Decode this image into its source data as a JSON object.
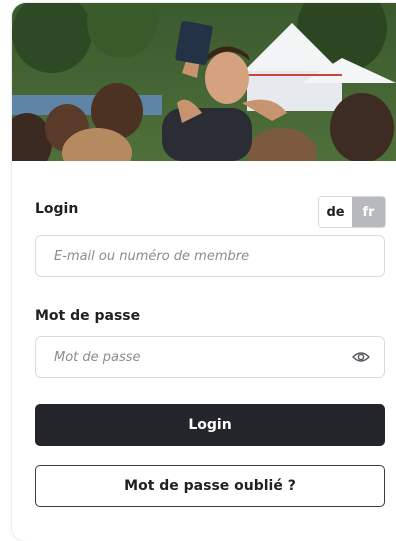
{
  "login": {
    "label": "Login",
    "placeholder": "E-mail ou numéro de membre"
  },
  "language": {
    "options": [
      "de",
      "fr"
    ],
    "selected": "fr"
  },
  "password": {
    "label": "Mot de passe",
    "placeholder": "Mot de passe"
  },
  "buttons": {
    "login": "Login",
    "forgot": "Mot de passe oublié ?"
  },
  "colors": {
    "primary_button": "#23252b",
    "active_language": "#b8b9bb",
    "border": "#d9dbdf"
  },
  "icons": {
    "password_toggle": "eye-icon"
  }
}
